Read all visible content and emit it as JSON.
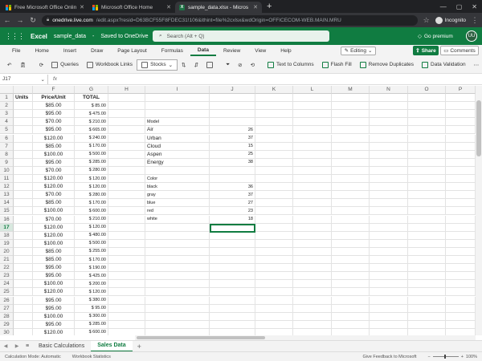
{
  "browser": {
    "tabs": [
      {
        "title": "Free Microsoft Office Online",
        "icon": "office-icon"
      },
      {
        "title": "Microsoft Office Home",
        "icon": "office-icon"
      },
      {
        "title": "sample_data.xlsx - Micros",
        "icon": "excel-icon",
        "active": true
      }
    ],
    "new_tab": "+",
    "url_host": "onedrive.live.com",
    "url_rest": "/edit.aspx?resid=D63BCF55F8FDEC31!106&ithint=file%2cxlsx&wdOrigin=OFFICECOM-WEB.MAIN.MRU",
    "profile": "Incognito"
  },
  "excel": {
    "app_name": "Excel",
    "doc_name": "sample_data",
    "saved_status": "Saved to OneDrive",
    "search_placeholder": "Search (Alt + Q)",
    "premium": "Go premium",
    "avatar_initials": "UU",
    "accent": "#107c41"
  },
  "menu": {
    "items": [
      "File",
      "Home",
      "Insert",
      "Draw",
      "Page Layout",
      "Formulas",
      "Data",
      "Review",
      "View",
      "Help"
    ],
    "active": "Data",
    "editing": "Editing",
    "share": "Share",
    "comments": "Comments"
  },
  "toolbar": {
    "queries": "Queries",
    "workbook_links": "Workbook Links",
    "stocks": "Stocks",
    "text_to_columns": "Text to Columns",
    "flash_fill": "Flash Fill",
    "remove_duplicates": "Remove Duplicates",
    "data_validation": "Data Validation"
  },
  "formula_bar": {
    "name_box": "J17",
    "fx": "fx",
    "value": ""
  },
  "columns": [
    "F",
    "G",
    "H",
    "I",
    "J",
    "K",
    "L",
    "M",
    "N",
    "O",
    "P"
  ],
  "rows": [
    "1",
    "2",
    "3",
    "4",
    "5",
    "6",
    "7",
    "8",
    "9",
    "10",
    "11",
    "12",
    "13",
    "14",
    "15",
    "16",
    "17",
    "18",
    "19",
    "20",
    "21",
    "22",
    "23",
    "24",
    "25",
    "26",
    "27",
    "28",
    "29",
    "30",
    "31"
  ],
  "col_e_header": "Units",
  "col_f": [
    "Price/Unit",
    "$85.00",
    "$95.00",
    "$70.00",
    "$95.00",
    "$120.00",
    "$85.00",
    "$100.00",
    "$95.00",
    "$70.00",
    "$120.00",
    "$120.00",
    "$70.00",
    "$85.00",
    "$100.00",
    "$70.00",
    "$120.00",
    "$120.00",
    "$100.00",
    "$85.00",
    "$85.00",
    "$95.00",
    "$95.00",
    "$100.00",
    "$120.00",
    "$95.00",
    "$95.00",
    "$100.00",
    "$95.00",
    "$120.00",
    "$100.00"
  ],
  "col_g": [
    "TOTAL",
    "$ 85.00",
    "$ 475.00",
    "$ 210.00",
    "$ 665.00",
    "$ 240.00",
    "$ 170.00",
    "$ 500.00",
    "$ 285.00",
    "$ 280.00",
    "$ 120.00",
    "$ 120.00",
    "$ 280.00",
    "$ 170.00",
    "$ 600.00",
    "$ 210.00",
    "$ 120.00",
    "$ 480.00",
    "$ 500.00",
    "$ 255.00",
    "$ 170.00",
    "$ 190.00",
    "$ 425.00",
    "$ 200.00",
    "$ 120.00",
    "$ 380.00",
    "$ 95.00",
    "$ 300.00",
    "$ 285.00",
    "$ 600.00",
    "$ 100.00"
  ],
  "summary_model": {
    "header": "Model",
    "rows": [
      [
        "Air",
        "26"
      ],
      [
        "Urban",
        "37"
      ],
      [
        "Cloud",
        "15"
      ],
      [
        "Aspen",
        "25"
      ],
      [
        "Energy",
        "38"
      ]
    ]
  },
  "summary_color": {
    "header": "Color",
    "rows": [
      [
        "black",
        "36"
      ],
      [
        "gray",
        "37"
      ],
      [
        "blue",
        "27"
      ],
      [
        "red",
        "23"
      ],
      [
        "white",
        "18"
      ]
    ]
  },
  "sheets": [
    "Basic Calculations",
    "Sales Data"
  ],
  "active_sheet": "Sales Data",
  "status": {
    "calc_mode": "Calculation Mode: Automatic",
    "workbook_stats": "Workbook Statistics",
    "feedback": "Give Feedback to Microsoft",
    "zoom": "100%"
  }
}
